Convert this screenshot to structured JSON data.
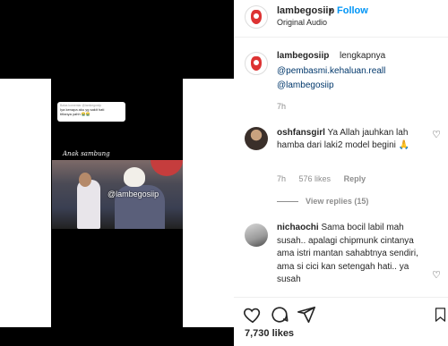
{
  "post": {
    "username": "lambegosiip",
    "follow_label": "Follow",
    "separator": "•",
    "audio": "Original Audio"
  },
  "media": {
    "comment_card_tiny": "Balas komentar @lambegosiip",
    "comment_card_line1": "Iya kenapa aku yg sakit hati",
    "comment_card_line2": "tiñanya yahh 😭😭",
    "caption_overlay": "Anak sambung",
    "watermark": "@lambegosiip"
  },
  "caption": {
    "username": "lambegosiip",
    "text": "lengkapnya",
    "link1": "@pembasmi.kehaluan.reall",
    "link2": "@lambegosiip",
    "time": "7h"
  },
  "comments": [
    {
      "username": "oshfansgirl",
      "text": "Ya Allah jauhkan lah hamba dari laki2 model begini 🙏",
      "time": "7h",
      "likes": "576 likes",
      "reply_label": "Reply",
      "view_replies": "View replies (15)"
    },
    {
      "username": "nichaochi",
      "text": "Sama bocil labil mah susah.. apalagi chipmunk cintanya ama istri mantan sahabtnya sendiri, ama si cici kan setengah hati.. ya susah"
    }
  ],
  "footer": {
    "likes": "7,730 likes"
  },
  "icons": {
    "heart": "heart-icon",
    "comment": "comment-icon",
    "share": "share-icon",
    "bookmark": "bookmark-icon"
  },
  "colors": {
    "link": "#00376b",
    "follow": "#0095f6",
    "muted": "#8e8e8e"
  }
}
